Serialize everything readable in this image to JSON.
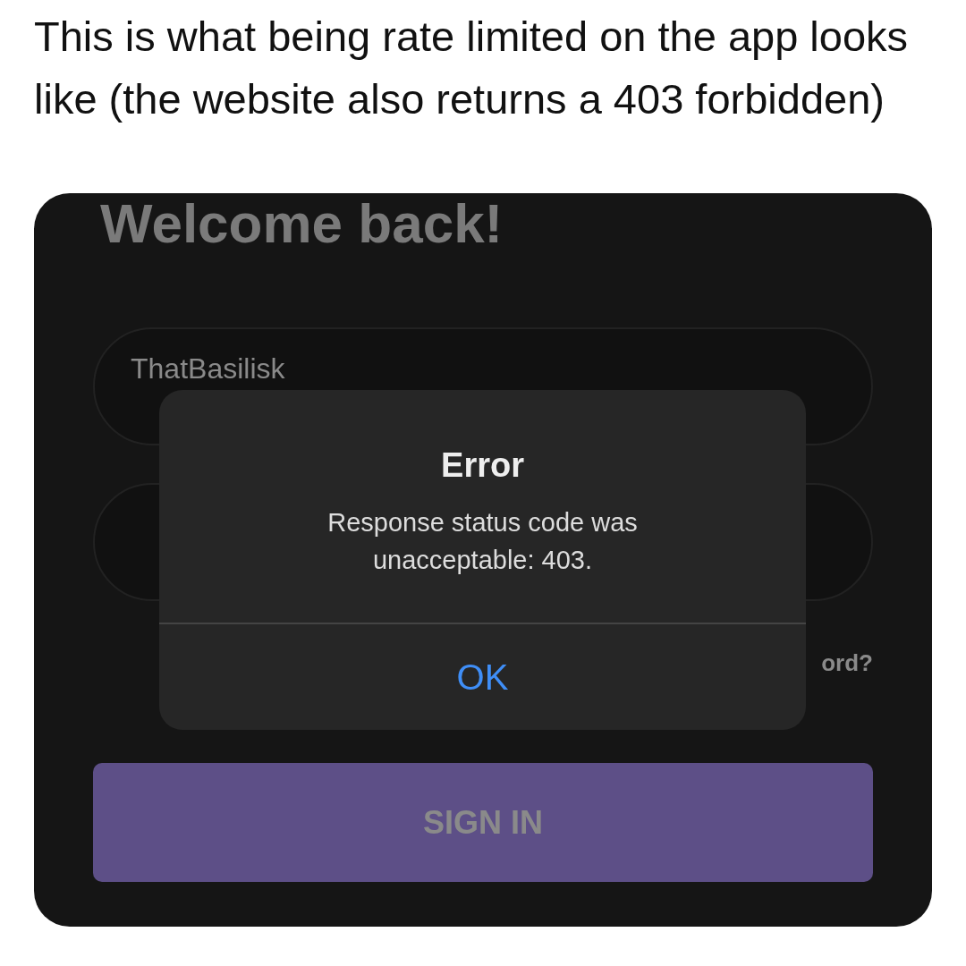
{
  "caption": "This is what being rate limited on the app looks like (the website also returns a 403 forbidden)",
  "login": {
    "heading": "Welcome back!",
    "username": "ThatBasilisk",
    "forgot_link": "ord?",
    "sign_in_button": "SIGN IN"
  },
  "alert": {
    "title": "Error",
    "message": "Response status code was unacceptable: 403.",
    "button": "OK"
  }
}
